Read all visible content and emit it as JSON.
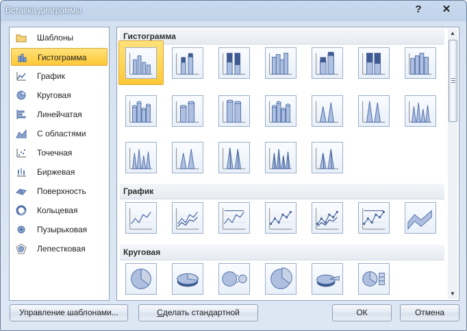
{
  "window": {
    "title": "Вставка диаграммы",
    "help_glyph": "?",
    "close_glyph": "✕"
  },
  "categories": [
    {
      "label": "Шаблоны",
      "icon": "folder-icon"
    },
    {
      "label": "Гистограмма",
      "icon": "column-chart-icon",
      "selected": true
    },
    {
      "label": "График",
      "icon": "line-chart-icon"
    },
    {
      "label": "Круговая",
      "icon": "pie-chart-icon"
    },
    {
      "label": "Линейчатая",
      "icon": "bar-chart-icon"
    },
    {
      "label": "С областями",
      "icon": "area-chart-icon"
    },
    {
      "label": "Точечная",
      "icon": "scatter-chart-icon"
    },
    {
      "label": "Биржевая",
      "icon": "stock-chart-icon"
    },
    {
      "label": "Поверхность",
      "icon": "surface-chart-icon"
    },
    {
      "label": "Кольцевая",
      "icon": "doughnut-chart-icon"
    },
    {
      "label": "Пузырьковая",
      "icon": "bubble-chart-icon"
    },
    {
      "label": "Лепестковая",
      "icon": "radar-chart-icon"
    }
  ],
  "gallery": {
    "sections": [
      {
        "title": "Гистограмма",
        "rows": [
          7,
          7,
          5
        ]
      },
      {
        "title": "График",
        "rows": [
          7
        ]
      },
      {
        "title": "Круговая",
        "rows": [
          6
        ]
      }
    ]
  },
  "buttons": {
    "manage_templates": "Управление шаблонами...",
    "set_default_prefix": "",
    "set_default_hotkey": "С",
    "set_default_rest": "делать стандартной",
    "ok": "ОК",
    "cancel": "Отмена"
  },
  "colors": {
    "selection": "#ffc836",
    "accent": "#4f6fa8"
  }
}
